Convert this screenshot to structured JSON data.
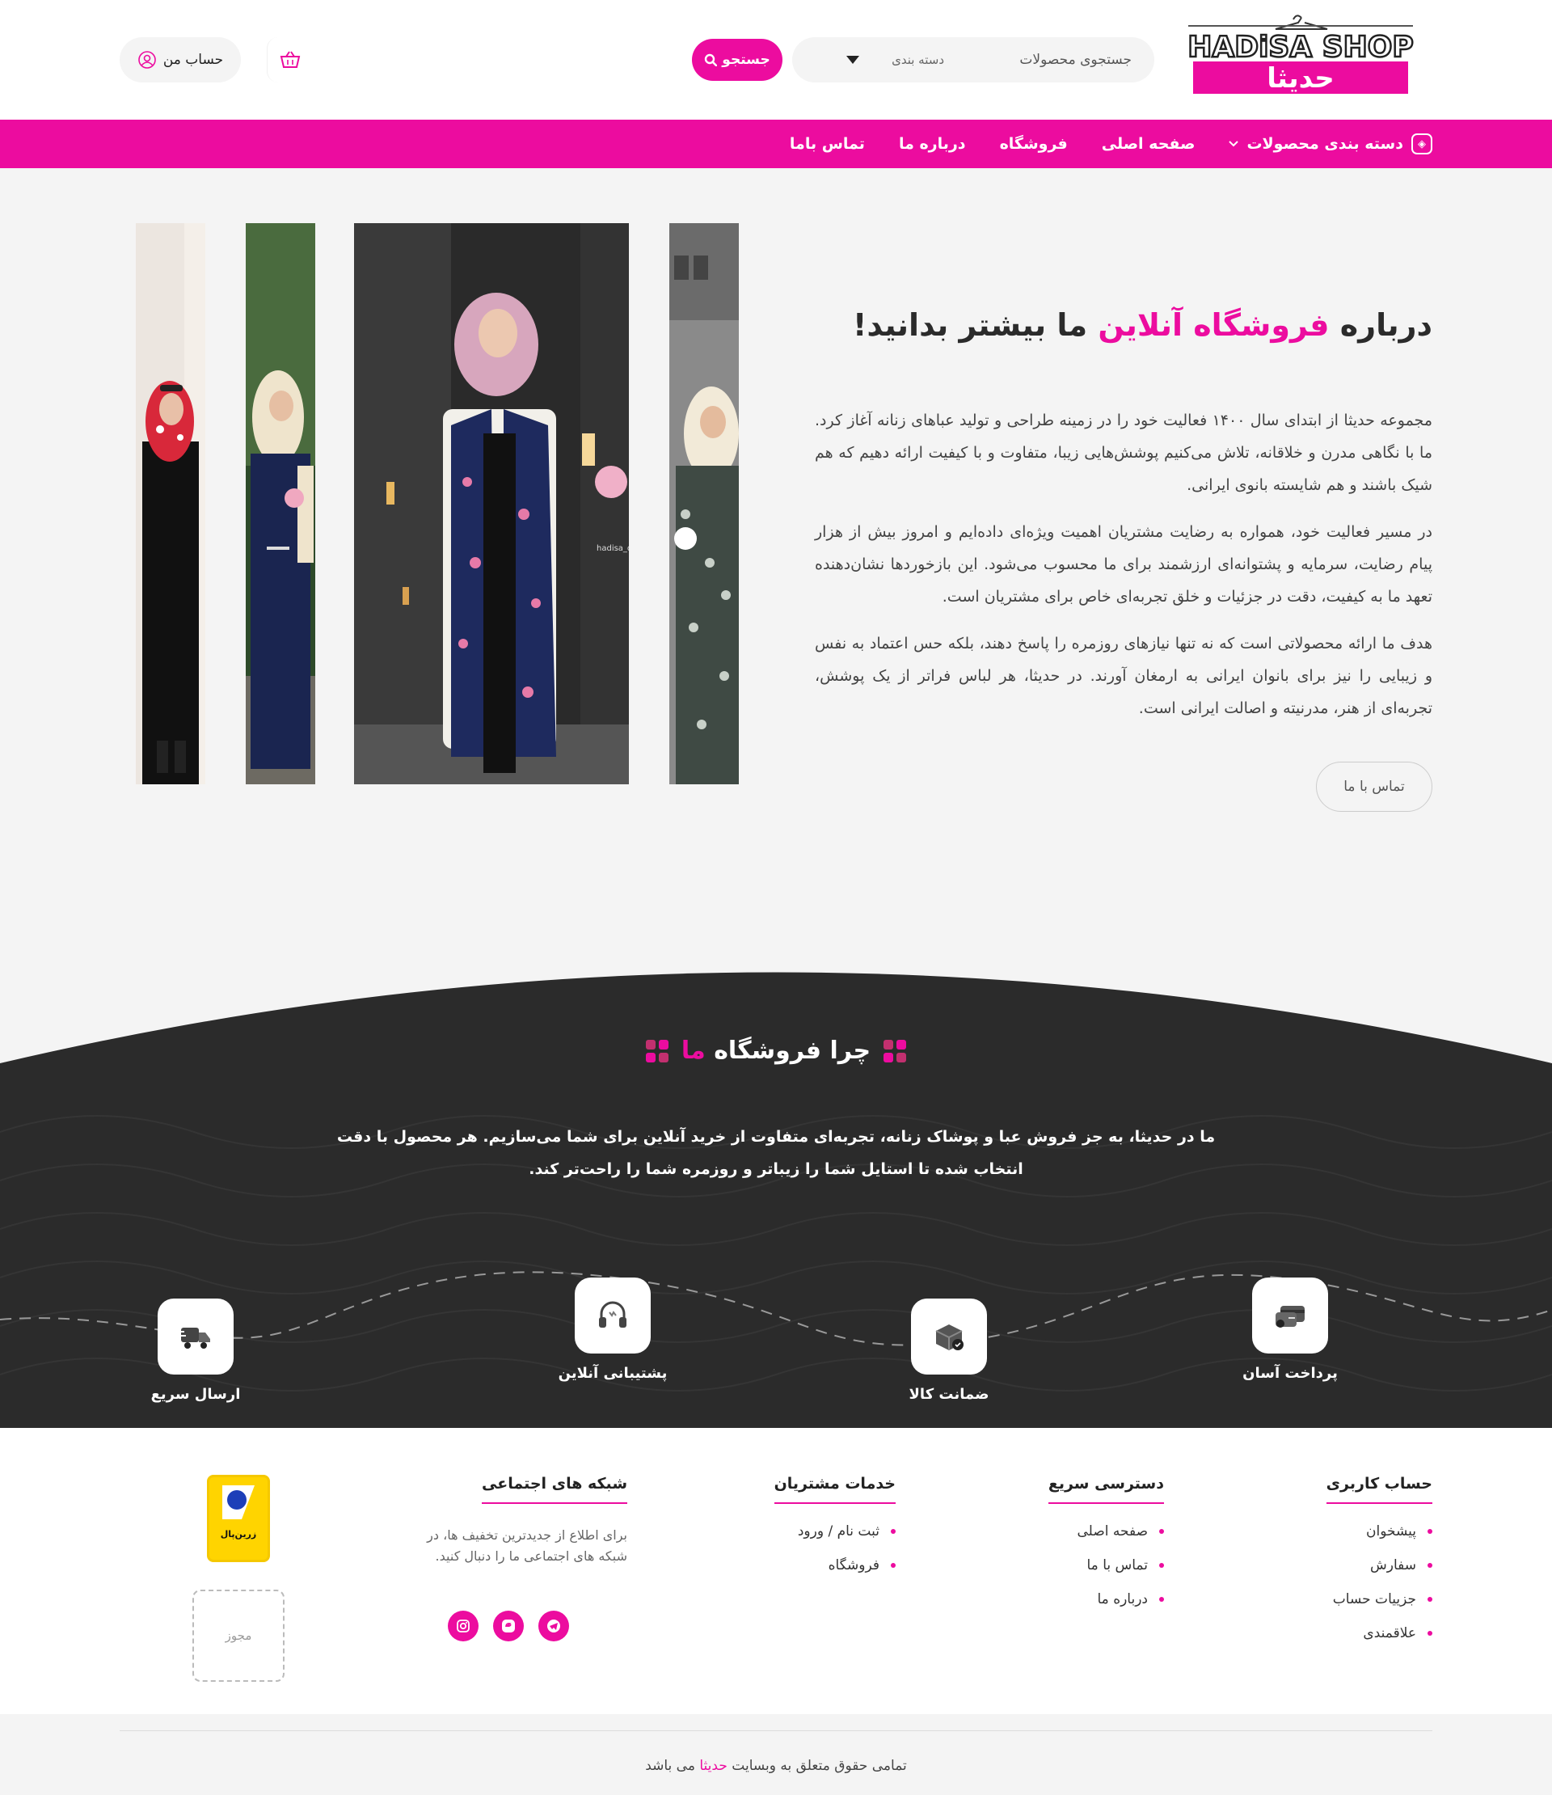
{
  "header": {
    "logo_text_en": "HADiSA SHOP",
    "logo_text_fa": "حدیثا",
    "search_placeholder": "جستجوی محصولات",
    "category_label": "دسته بندی",
    "search_button": "جستجو",
    "account_label": "حساب من"
  },
  "nav": {
    "items": [
      {
        "label": "دسته بندی محصولات"
      },
      {
        "label": "صفحه اصلی"
      },
      {
        "label": "فروشگاه"
      },
      {
        "label": "درباره ما"
      },
      {
        "label": "تماس باما"
      }
    ]
  },
  "about": {
    "title_before": "درباره ",
    "title_accent": "فروشگاه آنلاین",
    "title_after": " ما بیشتر بدانید!",
    "paragraphs": [
      "مجموعه حدیثا از ابتدای سال ۱۴۰۰ فعالیت خود را در زمینه طراحی و تولید عباهای زنانه آغاز کرد. ما با نگاهی مدرن و خلاقانه، تلاش می‌کنیم پوشش‌هایی زیبا، متفاوت و با کیفیت ارائه دهیم که هم شیک باشند و هم شایسته بانوی ایرانی.",
      "در مسیر فعالیت خود، همواره به رضایت مشتریان اهمیت ویژه‌ای داده‌ایم و امروز بیش از هزار پیام رضایت، سرمایه و پشتوانه‌ای ارزشمند برای ما محسوب می‌شود. این بازخوردها نشان‌دهنده تعهد ما به کیفیت، دقت در جزئیات و خلق تجربه‌ای خاص برای مشتریان است.",
      "هدف ما ارائه محصولاتی است که نه تنها نیازهای روزمره را پاسخ دهند، بلکه حس اعتماد به نفس و زیبایی را نیز برای بانوان ایرانی به ارمغان آورند. در حدیثا، هر لباس فراتر از یک پوشش، تجربه‌ای از هنر، مدرنیته و اصالت ایرانی است."
    ],
    "contact_button": "تماس با ما",
    "photo_watermark": "hadisa_design"
  },
  "why": {
    "title_before": "چرا فروشگاه ",
    "title_accent": "ما",
    "text": "ما در حدیثا، به جز فروش عبا و پوشاک زنانه، تجربه‌ای متفاوت از خرید آنلاین برای شما می‌سازیم. هر محصول با دقت انتخاب شده تا استایل شما را زیباتر و روزمره شما را راحت‌تر کند.",
    "features": [
      {
        "label": "پرداخت آسان",
        "icon": "payment-icon"
      },
      {
        "label": "ضمانت کالا",
        "icon": "guarantee-box-icon"
      },
      {
        "label": "پشتیبانی آنلاین",
        "icon": "headset-icon"
      },
      {
        "label": "ارسال سریع",
        "icon": "delivery-truck-icon"
      }
    ]
  },
  "footer": {
    "account": {
      "title": "حساب کاربری",
      "items": [
        "پیشخوان",
        "سفارش",
        "جزییات حساب",
        "علاقمندی"
      ]
    },
    "quick": {
      "title": "دسترسی سریع",
      "items": [
        "صفحه اصلی",
        "تماس با ما",
        "درباره ما"
      ]
    },
    "services": {
      "title": "خدمات مشتریان",
      "items": [
        "ثبت نام / ورود",
        "فروشگاه"
      ]
    },
    "social": {
      "title": "شبکه های اجتماعی",
      "text": "برای اطلاع از جدیدترین تخفیف ها، در شبکه های اجتماعی ما را دنبال کنید."
    },
    "zarinpal_label": "زرین‌پال",
    "license_label": "مجوز",
    "copyright_before": "تمامی حقوق متعلق به وبسایت ",
    "copyright_brand": "حدیثا",
    "copyright_after": " می باشد"
  },
  "colors": {
    "accent": "#ec0c9f",
    "dark": "#2b2b2b"
  }
}
